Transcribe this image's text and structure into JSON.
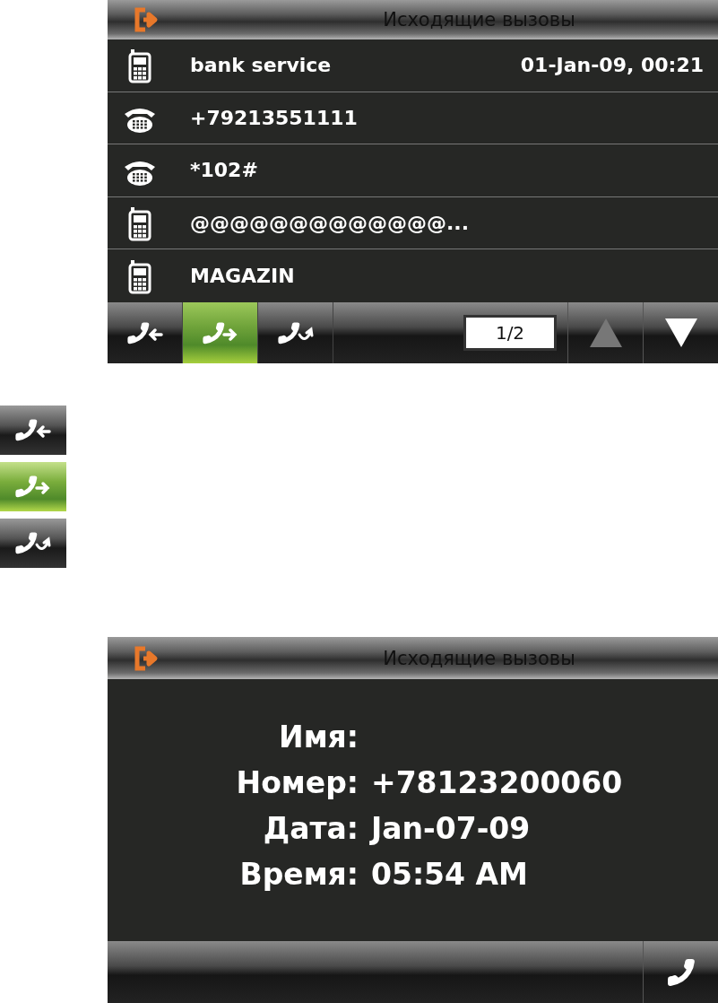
{
  "list_screen": {
    "title": "Исходящие вызовы",
    "calls": [
      {
        "kind": "mobile",
        "name": "bank service",
        "time": "01-Jan-09, 00:21"
      },
      {
        "kind": "landline",
        "name": "+79213551111"
      },
      {
        "kind": "landline",
        "name": "*102#"
      },
      {
        "kind": "mobile",
        "name": "@@@@@@@@@@@@@..."
      },
      {
        "kind": "mobile",
        "name": "MAGAZIN"
      }
    ],
    "tabs": [
      {
        "kind": "incoming",
        "selected": false
      },
      {
        "kind": "outgoing",
        "selected": true
      },
      {
        "kind": "missed",
        "selected": false
      }
    ],
    "page": "1/2"
  },
  "legend": [
    {
      "kind": "incoming",
      "selected": false
    },
    {
      "kind": "outgoing",
      "selected": true
    },
    {
      "kind": "missed",
      "selected": false
    }
  ],
  "detail_screen": {
    "title": "Исходящие вызовы",
    "fields": [
      {
        "label": "Имя:"
      },
      {
        "label": "Номер:",
        "value": "+78123200060"
      },
      {
        "label": "Дата:",
        "value": "Jan-07-09"
      },
      {
        "label": "Время:",
        "value": "05:54 AM"
      }
    ]
  }
}
